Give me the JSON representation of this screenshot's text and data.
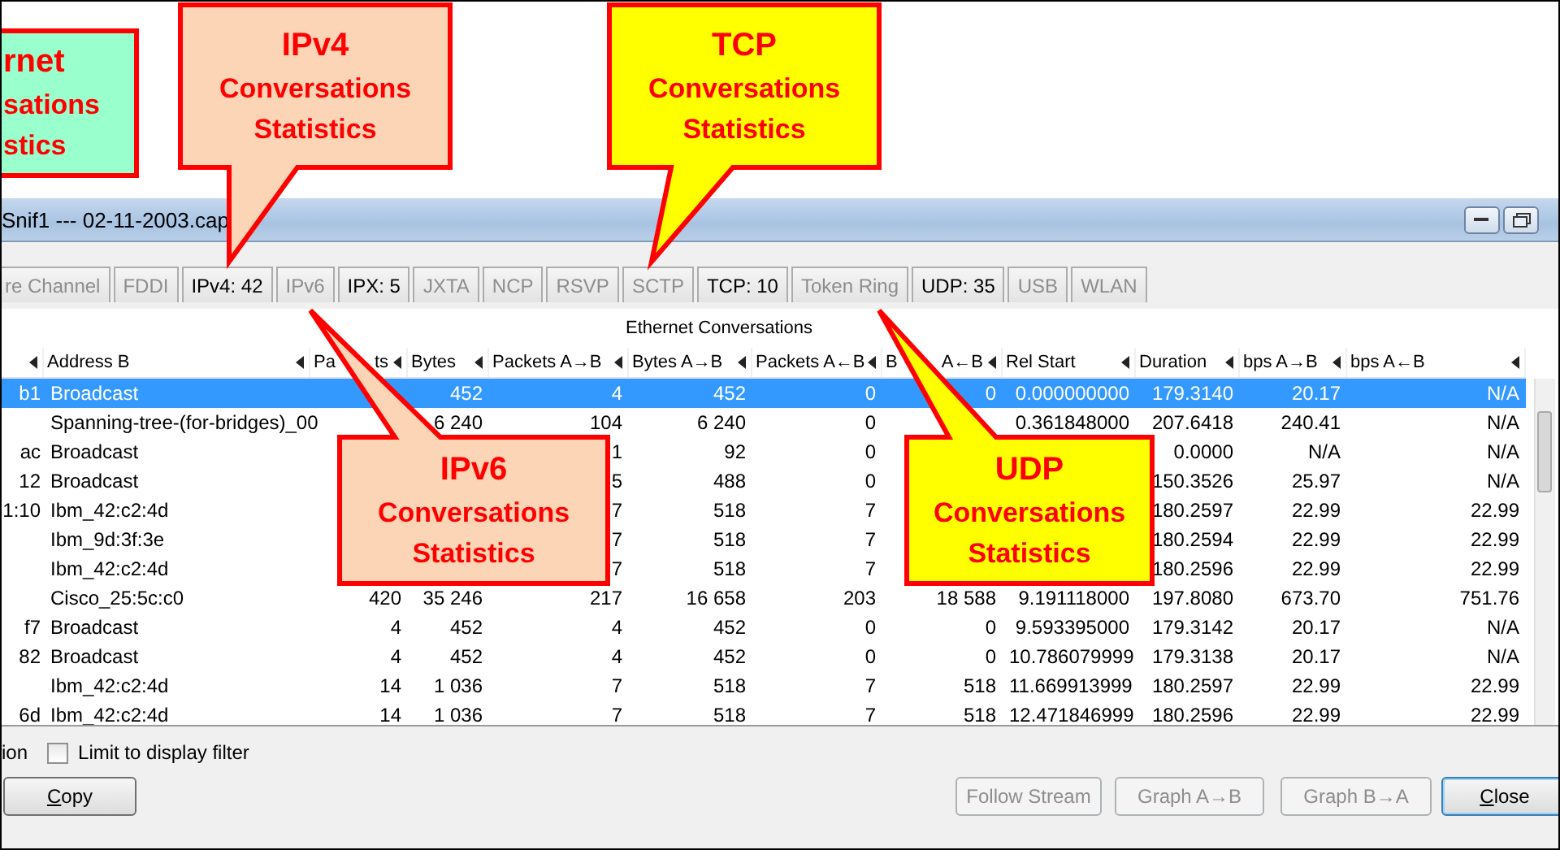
{
  "window": {
    "title": "Snif1 --- 02-11-2003.cap"
  },
  "tabs": [
    {
      "label": "re Channel",
      "disabled": true
    },
    {
      "label": "FDDI",
      "disabled": true
    },
    {
      "label": "IPv4: 42",
      "disabled": false
    },
    {
      "label": "IPv6",
      "disabled": true
    },
    {
      "label": "IPX: 5",
      "disabled": false
    },
    {
      "label": "JXTA",
      "disabled": true
    },
    {
      "label": "NCP",
      "disabled": true
    },
    {
      "label": "RSVP",
      "disabled": true
    },
    {
      "label": "SCTP",
      "disabled": true
    },
    {
      "label": "TCP: 10",
      "disabled": false
    },
    {
      "label": "Token Ring",
      "disabled": true
    },
    {
      "label": "UDP: 35",
      "disabled": false
    },
    {
      "label": "USB",
      "disabled": true
    },
    {
      "label": "WLAN",
      "disabled": true
    }
  ],
  "section_title": "Ethernet Conversations",
  "table": {
    "columns": [
      {
        "kind": "cut"
      },
      {
        "kind": "text",
        "label": "Address B"
      },
      {
        "kind": "split",
        "parts": [
          "Pa",
          "ts"
        ]
      },
      {
        "kind": "text",
        "label": "Bytes"
      },
      {
        "kind": "text",
        "label": "Packets A→B"
      },
      {
        "kind": "text",
        "label": "Bytes A→B"
      },
      {
        "kind": "text",
        "label": "Packets A←B"
      },
      {
        "kind": "split",
        "parts": [
          "B",
          "A←B"
        ]
      },
      {
        "kind": "text",
        "label": "Rel Start"
      },
      {
        "kind": "text",
        "label": "Duration"
      },
      {
        "kind": "text",
        "label": "bps A→B"
      },
      {
        "kind": "text",
        "label": "bps A←B"
      }
    ],
    "rows": [
      {
        "selected": true,
        "cells": [
          "b1",
          "Broadcast",
          null,
          "452",
          "4",
          "452",
          "0",
          "0",
          "0.000000000",
          "179.3140",
          "20.17",
          "N/A"
        ]
      },
      {
        "selected": false,
        "cells": [
          null,
          "Spanning-tree-(for-bridges)_00",
          null,
          "6 240",
          "104",
          "6 240",
          "0",
          null,
          "0.361848000",
          "207.6418",
          "240.41",
          "N/A"
        ]
      },
      {
        "selected": false,
        "cells": [
          "ac",
          "Broadcast",
          null,
          null,
          "1",
          "92",
          "0",
          null,
          null,
          "0.0000",
          "N/A",
          "N/A"
        ]
      },
      {
        "selected": false,
        "cells": [
          "12",
          "Broadcast",
          null,
          null,
          "5",
          "488",
          "0",
          null,
          null,
          "150.3526",
          "25.97",
          "N/A"
        ]
      },
      {
        "selected": false,
        "cells": [
          "1:10",
          "Ibm_42:c2:4d",
          null,
          null,
          "7",
          "518",
          "7",
          null,
          null,
          "180.2597",
          "22.99",
          "22.99"
        ]
      },
      {
        "selected": false,
        "cells": [
          null,
          "Ibm_9d:3f:3e",
          null,
          null,
          "7",
          "518",
          "7",
          null,
          null,
          "180.2594",
          "22.99",
          "22.99"
        ]
      },
      {
        "selected": false,
        "cells": [
          null,
          "Ibm_42:c2:4d",
          null,
          null,
          "7",
          "518",
          "7",
          null,
          null,
          "180.2596",
          "22.99",
          "22.99"
        ]
      },
      {
        "selected": false,
        "cells": [
          null,
          "Cisco_25:5c:c0",
          "420",
          "35 246",
          "217",
          "16 658",
          "203",
          "18 588",
          "9.191118000",
          "197.8080",
          "673.70",
          "751.76"
        ]
      },
      {
        "selected": false,
        "cells": [
          "f7",
          "Broadcast",
          "4",
          "452",
          "4",
          "452",
          "0",
          "0",
          "9.593395000",
          "179.3142",
          "20.17",
          "N/A"
        ]
      },
      {
        "selected": false,
        "cells": [
          "82",
          "Broadcast",
          "4",
          "452",
          "4",
          "452",
          "0",
          "0",
          "10.786079999",
          "179.3138",
          "20.17",
          "N/A"
        ]
      },
      {
        "selected": false,
        "cells": [
          null,
          "Ibm_42:c2:4d",
          "14",
          "1 036",
          "7",
          "518",
          "7",
          "518",
          "11.669913999",
          "180.2597",
          "22.99",
          "22.99"
        ]
      },
      {
        "selected": false,
        "cells": [
          "6d",
          "Ibm_42:c2:4d",
          "14",
          "1 036",
          "7",
          "518",
          "7",
          "518",
          "12.471846999",
          "180.2596",
          "22.99",
          "22.99"
        ]
      }
    ]
  },
  "options": {
    "cut_label": "ion",
    "limit_filter": {
      "label": "Limit to display filter",
      "checked": false
    }
  },
  "buttons": [
    {
      "label": "Copy",
      "disabled": false,
      "focused": false
    },
    {
      "label": "Follow Stream",
      "disabled": true,
      "focused": false
    },
    {
      "label": "Graph A→B",
      "disabled": true,
      "focused": false
    },
    {
      "label": "Graph B→A",
      "disabled": true,
      "focused": false
    },
    {
      "label": "Close",
      "disabled": false,
      "focused": true
    }
  ],
  "callouts": [
    {
      "lines": [
        "rnet",
        "sations",
        "stics"
      ],
      "color": "#99ffcc"
    },
    {
      "lines": [
        "IPv4",
        "Conversations",
        "Statistics"
      ],
      "color": "#fbd5b5"
    },
    {
      "lines": [
        "TCP",
        "Conversations",
        "Statistics"
      ],
      "color": "#ffff00"
    },
    {
      "lines": [
        "IPv6",
        "Conversations",
        "Statistics"
      ],
      "color": "#fbd5b5"
    },
    {
      "lines": [
        "UDP",
        "Conversations",
        "Statistics"
      ],
      "color": "#ffff00"
    }
  ]
}
